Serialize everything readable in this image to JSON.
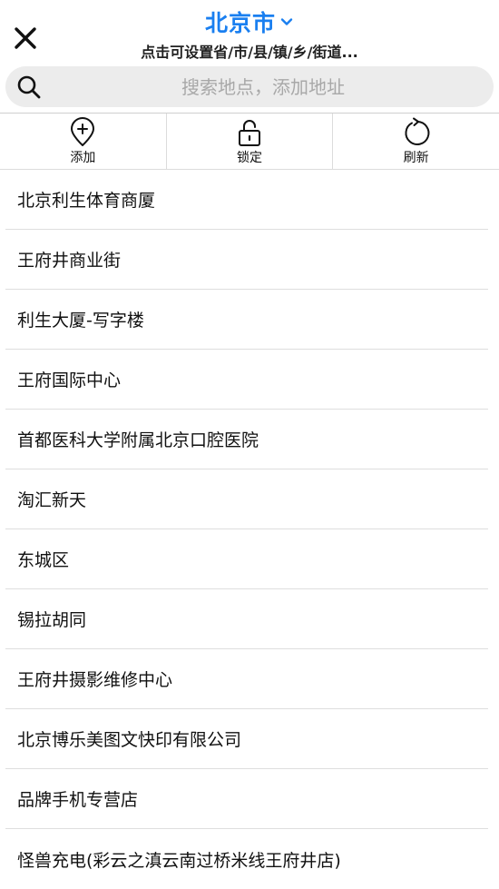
{
  "header": {
    "city": "北京市",
    "subtitle": "点击可设置省/市/县/镇/乡/街道..."
  },
  "search": {
    "placeholder": "搜索地点，添加地址"
  },
  "toolbar": {
    "add_label": "添加",
    "lock_label": "锁定",
    "refresh_label": "刷新"
  },
  "places": [
    "北京利生体育商厦",
    "王府井商业街",
    "利生大厦-写字楼",
    "王府国际中心",
    "首都医科大学附属北京口腔医院",
    "淘汇新天",
    "东城区",
    "锡拉胡同",
    "王府井摄影维修中心",
    "北京博乐美图文快印有限公司",
    "品牌手机专营店",
    "怪兽充电(彩云之滇云南过桥米线王府井店)"
  ],
  "colors": {
    "accent": "#1a7ff0",
    "search_bg": "#ececec",
    "divider": "#dedede"
  },
  "icons": [
    "close-icon",
    "chevron-down-icon",
    "search-icon",
    "add-location-icon",
    "unlock-icon",
    "refresh-icon"
  ]
}
